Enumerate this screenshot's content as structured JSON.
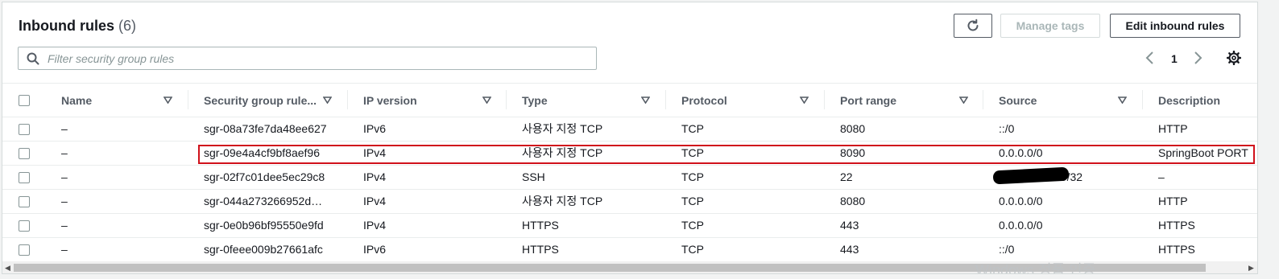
{
  "header": {
    "title": "Inbound rules",
    "count": "(6)",
    "manage_tags_label": "Manage tags",
    "edit_label": "Edit inbound rules"
  },
  "search": {
    "placeholder": "Filter security group rules",
    "value": ""
  },
  "pagination": {
    "current_page": "1"
  },
  "table": {
    "columns": [
      "Name",
      "Security group rule...",
      "IP version",
      "Type",
      "Protocol",
      "Port range",
      "Source",
      "Description"
    ],
    "rows": [
      {
        "name": "–",
        "rule_id": "sgr-08a73fe7da48ee627",
        "ip_version": "IPv6",
        "type": "사용자 지정 TCP",
        "protocol": "TCP",
        "port_range": "8080",
        "source": "::/0",
        "description": "HTTP"
      },
      {
        "name": "–",
        "rule_id": "sgr-09e4a4cf9bf8aef96",
        "ip_version": "IPv4",
        "type": "사용자 지정 TCP",
        "protocol": "TCP",
        "port_range": "8090",
        "source": "0.0.0.0/0",
        "description": "SpringBoot PORT"
      },
      {
        "name": "–",
        "rule_id": "sgr-02f7c01dee5ec29c8",
        "ip_version": "IPv4",
        "type": "SSH",
        "protocol": "TCP",
        "port_range": "22",
        "source": "50/32",
        "description": "–"
      },
      {
        "name": "–",
        "rule_id": "sgr-044a273266952d…",
        "ip_version": "IPv4",
        "type": "사용자 지정 TCP",
        "protocol": "TCP",
        "port_range": "8080",
        "source": "0.0.0.0/0",
        "description": "HTTP"
      },
      {
        "name": "–",
        "rule_id": "sgr-0e0b96bf95550e9fd",
        "ip_version": "IPv4",
        "type": "HTTPS",
        "protocol": "TCP",
        "port_range": "443",
        "source": "0.0.0.0/0",
        "description": "HTTPS"
      },
      {
        "name": "–",
        "rule_id": "sgr-0feee009b27661afc",
        "ip_version": "IPv6",
        "type": "HTTPS",
        "protocol": "TCP",
        "port_range": "443",
        "source": "::/0",
        "description": "HTTPS"
      }
    ]
  },
  "watermark": "Windows 정품 인증",
  "colors": {
    "highlight": "#d0111b",
    "text": "#16191f",
    "muted": "#545b64"
  }
}
